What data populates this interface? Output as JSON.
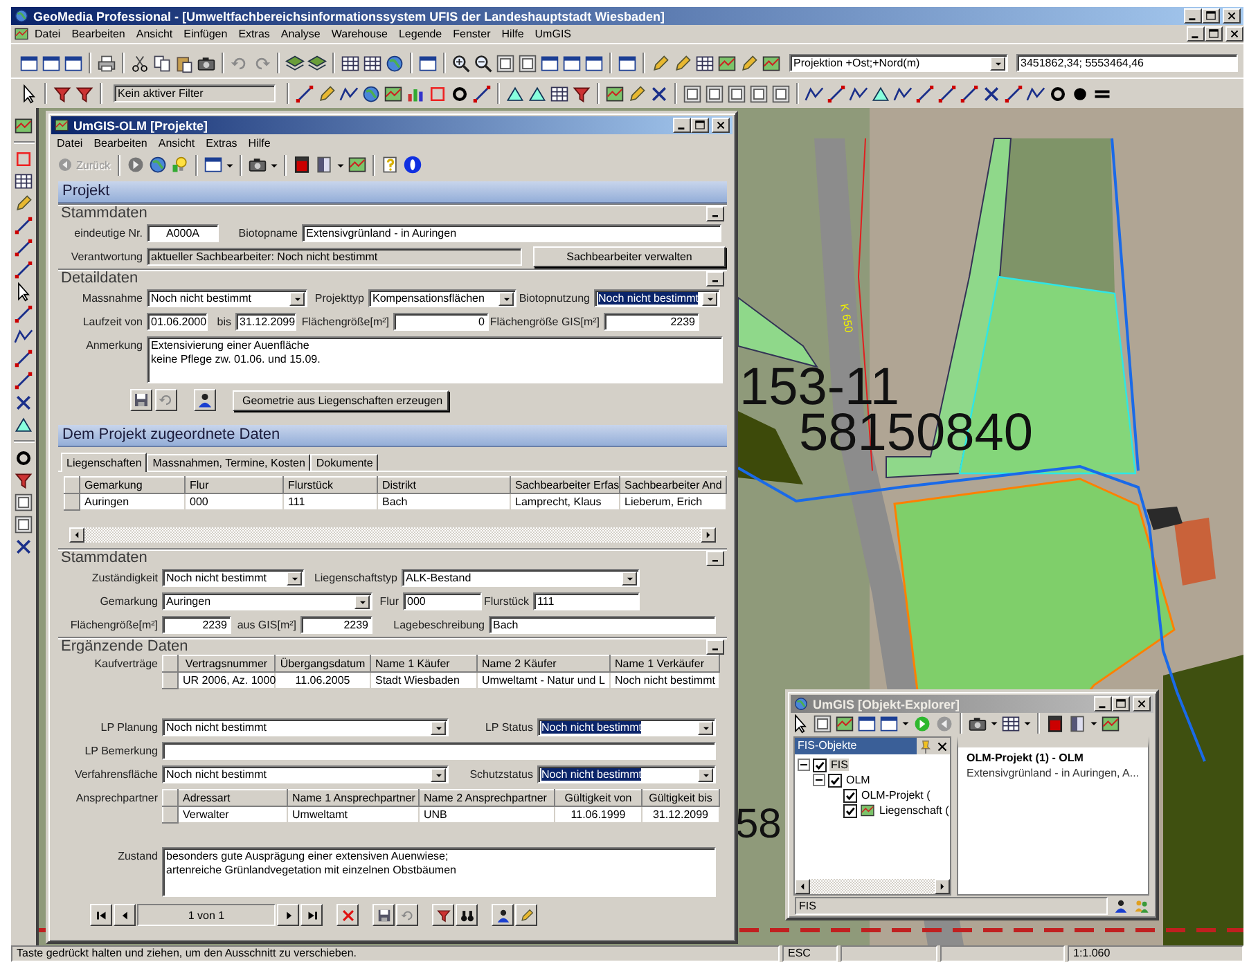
{
  "app_window": {
    "title": "GeoMedia Professional - [Umweltfachbereichsinformationssystem UFIS der Landeshauptstadt Wiesbaden]"
  },
  "menu_bar": [
    "Datei",
    "Bearbeiten",
    "Ansicht",
    "Einfügen",
    "Extras",
    "Analyse",
    "Warehouse",
    "Legende",
    "Fenster",
    "Hilfe",
    "UmGIS"
  ],
  "toolbar": {
    "projection": "Projektion +Ost;+Nord(m)",
    "coordinates": "3451862,34; 5553464,46",
    "filter": "Kein aktiver Filter"
  },
  "map": {
    "labels": [
      {
        "kind": "parcel",
        "text": "153-11"
      },
      {
        "kind": "parcel",
        "text": "58150840"
      },
      {
        "kind": "road",
        "text": "K 650"
      },
      {
        "kind": "parcel",
        "text": "58"
      }
    ]
  },
  "project_window": {
    "title": "UmGIS-OLM [Projekte]",
    "active": true,
    "menu": [
      "Datei",
      "Bearbeiten",
      "Ansicht",
      "Extras",
      "Hilfe"
    ],
    "back_button": {
      "label": "Zurück",
      "disabled": true
    },
    "content": [
      {
        "kind": "band",
        "title": "Projekt"
      },
      {
        "kind": "group",
        "title": "Stammdaten"
      },
      {
        "kind": "row",
        "fields": [
          {
            "label": "eindeutige Nr.",
            "kind": "code",
            "value": "A000A"
          },
          {
            "label": "Biotopname",
            "kind": "text",
            "value": "Extensivgrünland  - in Auringen"
          }
        ]
      },
      {
        "kind": "row",
        "fields": [
          {
            "label": "Verantwortung",
            "kind": "readonly",
            "value": "aktueller Sachbearbeiter: Noch nicht bestimmt"
          },
          {
            "kind": "button",
            "text": "Sachbearbeiter verwalten"
          }
        ]
      },
      {
        "kind": "group",
        "title": "Detaildaten"
      },
      {
        "kind": "row",
        "fields": [
          {
            "label": "Massnahme",
            "kind": "combo",
            "value": "Noch nicht bestimmt",
            "highlighted": false
          },
          {
            "label": "Projekttyp",
            "kind": "combo",
            "value": "Kompensationsflächen",
            "highlighted": false
          },
          {
            "label": "Biotopnutzung",
            "kind": "combo",
            "value": "Noch nicht bestimmt",
            "highlighted": true
          }
        ]
      },
      {
        "kind": "row",
        "fields": [
          {
            "label": "Laufzeit von",
            "kind": "text",
            "value": "01.06.2000"
          },
          {
            "label": "bis",
            "kind": "text",
            "value": "31.12.2099"
          },
          {
            "label": "Flächengröße[m²]",
            "kind": "number",
            "value": "0"
          },
          {
            "label": "Flächengröße GIS[m²]",
            "kind": "number",
            "value": "2239"
          }
        ]
      },
      {
        "kind": "row",
        "fields": [
          {
            "label": "Anmerkung",
            "kind": "area",
            "lines": [
              "Extensivierung einer Auenfläche",
              "keine Pflege zw. 01.06. und 15.09."
            ]
          }
        ]
      },
      {
        "kind": "actions",
        "button": "Geometrie aus Liegenschaften erzeugen"
      },
      {
        "kind": "band",
        "title": "Dem Projekt zugeordnete Daten"
      },
      {
        "kind": "tabs",
        "tabs": [
          {
            "label": "Liegenschaften",
            "selected": true
          },
          {
            "label": "Massnahmen, Termine, Kosten",
            "selected": false
          },
          {
            "label": "Dokumente",
            "selected": false
          }
        ]
      },
      {
        "kind": "grid",
        "columns": [
          "Gemarkung",
          "Flur",
          "Flurstück",
          "Distrikt",
          "Sachbearbeiter Erfas",
          "Sachbearbeiter And"
        ],
        "rows": [
          [
            "Auringen",
            "000",
            "111",
            "Bach",
            "Lamprecht, Klaus",
            "Lieberum, Erich"
          ]
        ]
      },
      {
        "kind": "group",
        "title": "Stammdaten"
      },
      {
        "kind": "row",
        "fields": [
          {
            "label": "Zuständigkeit",
            "kind": "combo",
            "value": "Noch nicht bestimmt",
            "highlighted": false
          },
          {
            "label": "Liegenschaftstyp",
            "kind": "combo",
            "value": "ALK-Bestand",
            "highlighted": false
          }
        ]
      },
      {
        "kind": "row",
        "fields": [
          {
            "label": "Gemarkung",
            "kind": "combo",
            "value": "Auringen",
            "highlighted": false
          },
          {
            "label": "Flur",
            "kind": "text",
            "value": "000"
          },
          {
            "label": "Flurstück",
            "kind": "text",
            "value": "111"
          }
        ]
      },
      {
        "kind": "row",
        "fields": [
          {
            "label": "Flächengröße[m²]",
            "kind": "number",
            "value": "2239"
          },
          {
            "label": "aus GIS[m²]",
            "kind": "number",
            "value": "2239"
          },
          {
            "label": "Lagebeschreibung",
            "kind": "text",
            "value": "Bach"
          }
        ]
      },
      {
        "kind": "group",
        "title": "Ergänzende Daten"
      },
      {
        "kind": "grid",
        "label": "Kaufverträge",
        "columns": [
          "Vertragsnummer",
          "Übergangsdatum",
          "Name 1 Käufer",
          "Name 2 Käufer",
          "Name 1 Verkäufer"
        ],
        "rows": [
          [
            "UR 2006, Az. 1000",
            "11.06.2005",
            "Stadt Wiesbaden",
            "Umweltamt - Natur und L",
            "Noch nicht bestimmt"
          ]
        ]
      },
      {
        "kind": "row",
        "fields": [
          {
            "label": "LP Planung",
            "kind": "combo",
            "value": "Noch nicht bestimmt",
            "highlighted": false
          },
          {
            "label": "LP Status",
            "kind": "combo",
            "value": "Noch nicht bestimmt",
            "highlighted": true
          }
        ]
      },
      {
        "kind": "row",
        "fields": [
          {
            "label": "LP Bemerkung",
            "kind": "text"
          }
        ]
      },
      {
        "kind": "row",
        "fields": [
          {
            "label": "Verfahrensfläche",
            "kind": "combo",
            "value": "Noch nicht bestimmt",
            "highlighted": false
          },
          {
            "label": "Schutzstatus",
            "kind": "combo",
            "value": "Noch nicht bestimmt",
            "highlighted": true
          }
        ]
      },
      {
        "kind": "grid",
        "label": "Ansprechpartner",
        "columns": [
          "Adressart",
          "Name 1 Ansprechpartner",
          "Name 2 Ansprechpartner",
          "Gültigkeit von",
          "Gültigkeit bis"
        ],
        "rows": [
          [
            "Verwalter",
            "Umweltamt",
            "UNB",
            "11.06.1999",
            "31.12.2099"
          ]
        ]
      },
      {
        "kind": "row",
        "fields": [
          {
            "label": "Zustand",
            "kind": "area",
            "lines": [
              "besonders gute Ausprägung einer extensiven Auenwiese;",
              "artenreiche Grünlandvegetation mit einzelnen Obstbäumen"
            ]
          }
        ]
      },
      {
        "kind": "navigator",
        "record": "1 von 1"
      }
    ]
  },
  "explorer_window": {
    "title": "UmGIS [Objekt-Explorer]",
    "active": false,
    "pane_title": "FIS-Objekte",
    "tree": [
      {
        "label": "FIS",
        "checked": true,
        "selected": true,
        "expanded": true,
        "children": [
          {
            "label": "OLM",
            "checked": true,
            "selected": false,
            "expanded": true,
            "children": [
              {
                "label": "OLM-Projekt (",
                "kind": "class",
                "checked": true,
                "selected": false
              },
              {
                "label": "Liegenschaft (",
                "kind": "layer",
                "checked": true,
                "selected": false
              }
            ]
          }
        ]
      }
    ],
    "detail": {
      "title": "OLM-Projekt (1) - OLM",
      "text": "Extensivgrünland  - in Auringen, A..."
    },
    "status": "FIS"
  },
  "status_bar": {
    "message": "Taste gedrückt halten und ziehen, um den Ausschnitt zu verschieben.",
    "panels": [
      "ESC",
      "1:1.060"
    ]
  }
}
